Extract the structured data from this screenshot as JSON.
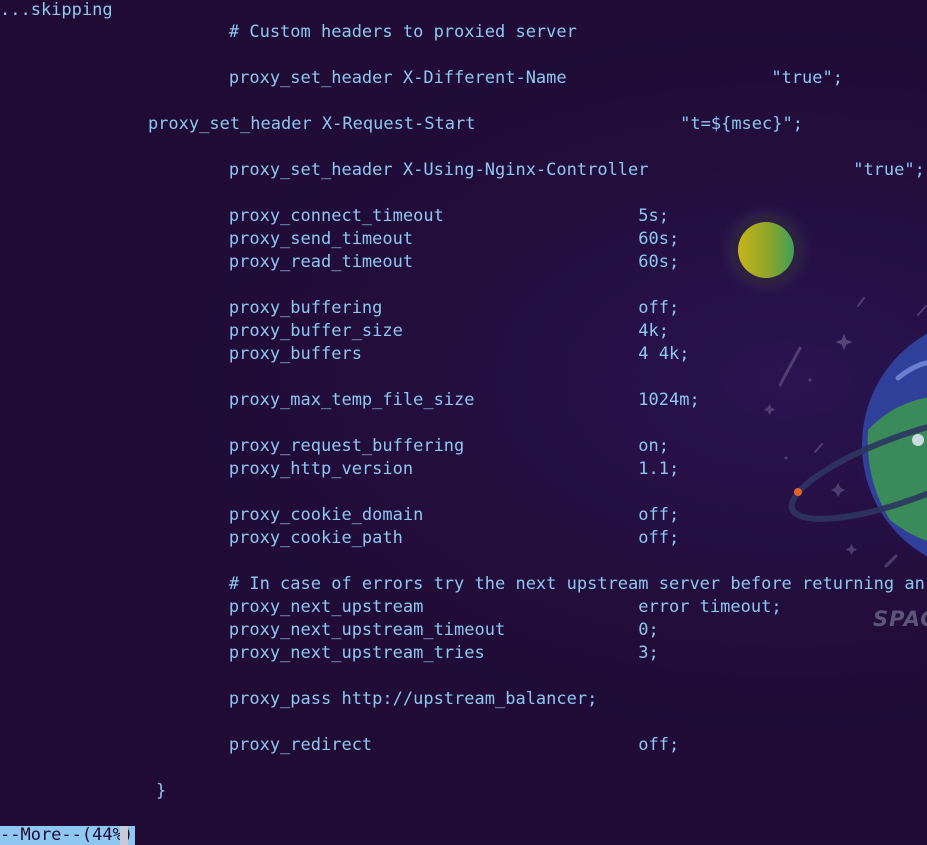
{
  "terminal": {
    "skipping_text": "...skipping",
    "lines": [
      "        # Custom headers to proxied server",
      "        proxy_set_header X-Different-Name                    \"true\";",
      "    proxy_set_header X-Request-Start                    \"t=${msec}\";",
      "        proxy_set_header X-Using-Nginx-Controller                    \"true\";",
      "        proxy_connect_timeout                   5s;",
      "        proxy_send_timeout                      60s;",
      "        proxy_read_timeout                      60s;",
      "        proxy_buffering                         off;",
      "        proxy_buffer_size                       4k;",
      "        proxy_buffers                           4 4k;",
      "        proxy_max_temp_file_size                1024m;",
      "        proxy_request_buffering                 on;",
      "        proxy_http_version                      1.1;",
      "        proxy_cookie_domain                     off;",
      "        proxy_cookie_path                       off;",
      "        # In case of errors try the next upstream server before returning an e",
      "        proxy_next_upstream                     error timeout;",
      "        proxy_next_upstream_timeout             0;",
      "        proxy_next_upstream_tries               3;",
      "        proxy_pass http://upstream_balancer;",
      "        proxy_redirect                          off;",
      "    }"
    ],
    "pager_status": "--More--(44%)"
  },
  "wallpaper": {
    "brand_text": "SPAC",
    "colors": {
      "background": "#1f0b33",
      "text": "#8ec8f0",
      "moon_yellow": "#c8b41a",
      "moon_green": "#3fa058",
      "planet_green": "#3a8a5a",
      "planet_blue": "#3460a8"
    }
  }
}
